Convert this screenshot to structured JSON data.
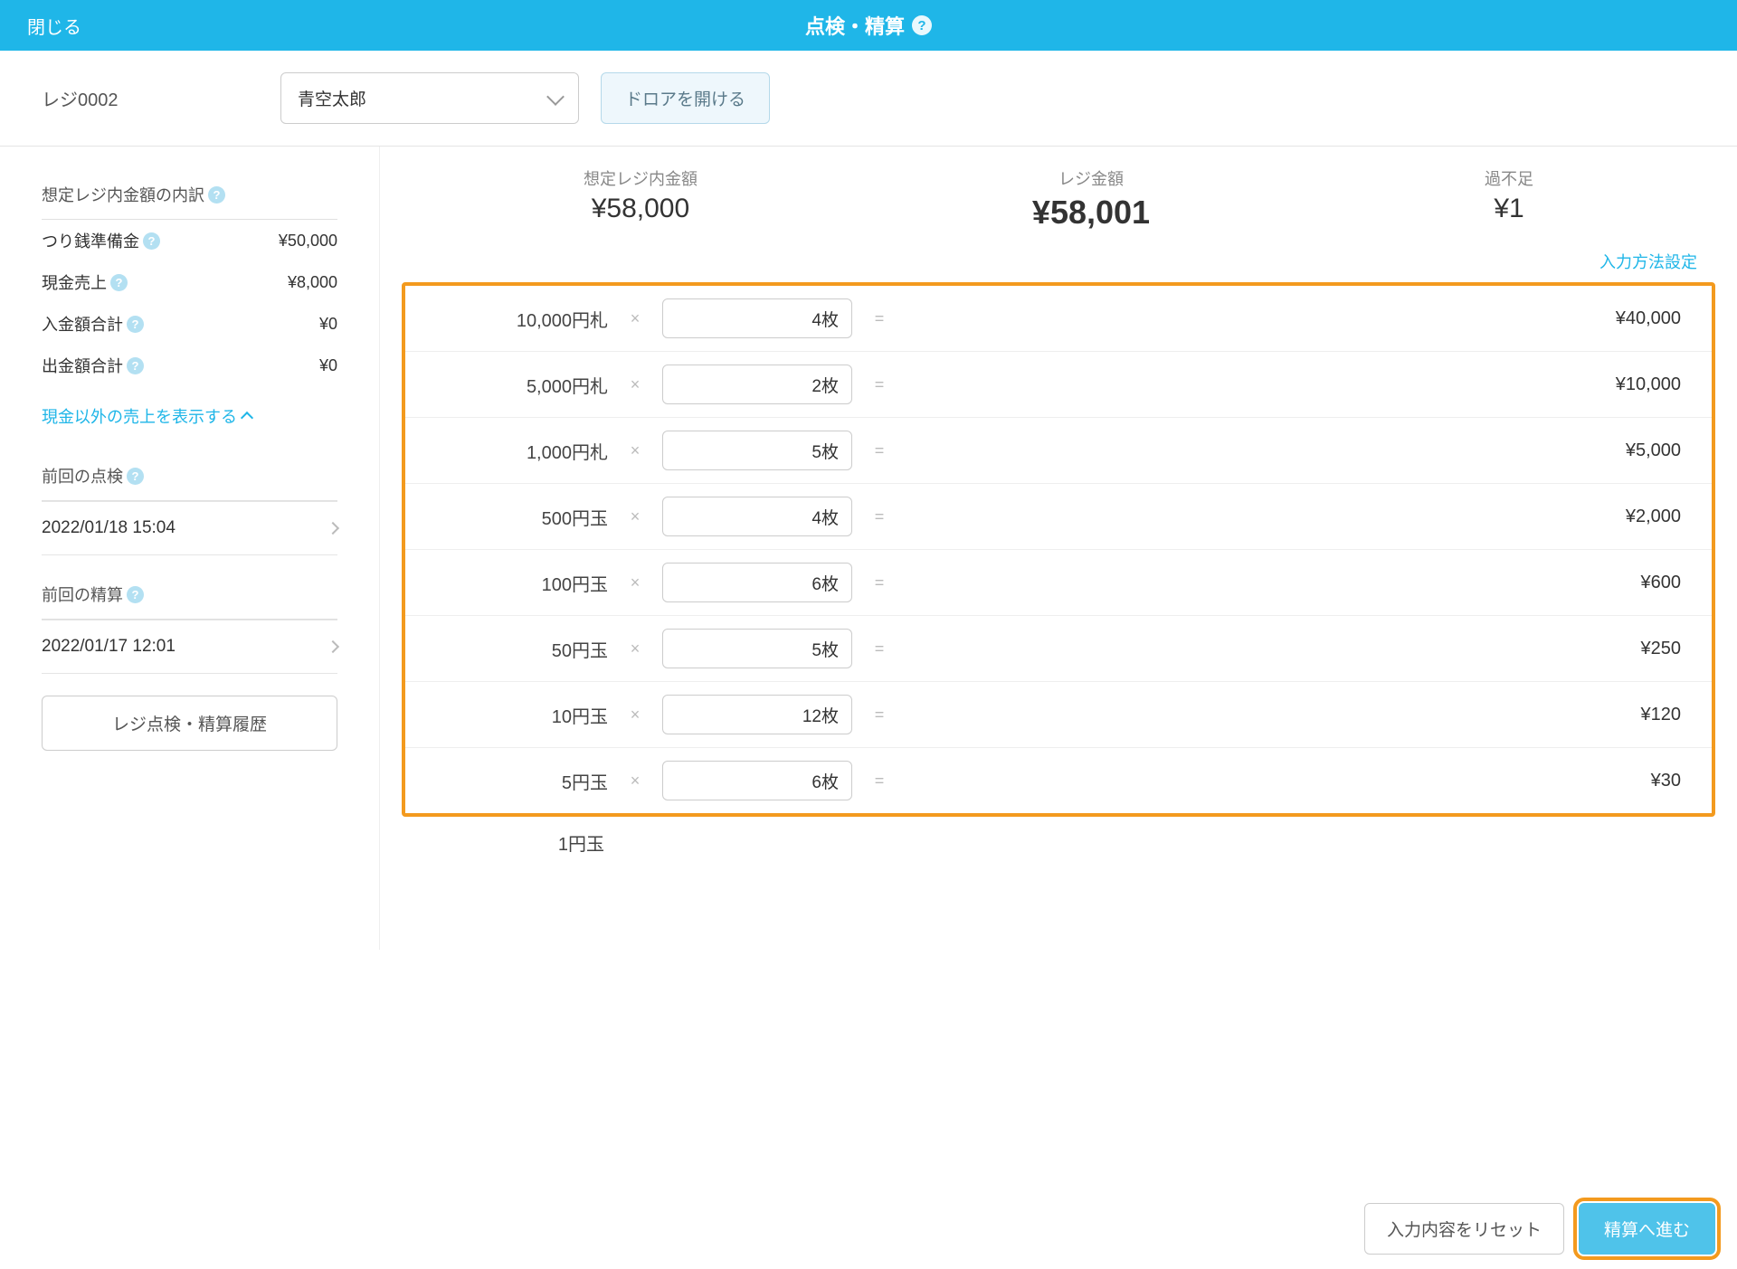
{
  "header": {
    "close": "閉じる",
    "title": "点検・精算"
  },
  "toolbar": {
    "register_label": "レジ0002",
    "staff_name": "青空太郎",
    "open_drawer": "ドロアを開ける"
  },
  "sidebar": {
    "breakdown_title": "想定レジ内金額の内訳",
    "rows": {
      "change_fund_label": "つり銭準備金",
      "change_fund_value": "¥50,000",
      "cash_sales_label": "現金売上",
      "cash_sales_value": "¥8,000",
      "deposit_label": "入金額合計",
      "deposit_value": "¥0",
      "withdrawal_label": "出金額合計",
      "withdrawal_value": "¥0"
    },
    "toggle_link": "現金以外の売上を表示する",
    "prev_check_title": "前回の点検",
    "prev_check_time": "2022/01/18 15:04",
    "prev_settle_title": "前回の精算",
    "prev_settle_time": "2022/01/17 12:01",
    "history_button": "レジ点検・精算履歴"
  },
  "main": {
    "summary": {
      "expected_label": "想定レジ内金額",
      "expected_value": "¥58,000",
      "actual_label": "レジ金額",
      "actual_value": "¥58,001",
      "diff_label": "過不足",
      "diff_value": "¥1"
    },
    "input_settings_link": "入力方法設定",
    "denominations": [
      {
        "label": "10,000円札",
        "count": "4枚",
        "subtotal": "¥40,000"
      },
      {
        "label": "5,000円札",
        "count": "2枚",
        "subtotal": "¥10,000"
      },
      {
        "label": "1,000円札",
        "count": "5枚",
        "subtotal": "¥5,000"
      },
      {
        "label": "500円玉",
        "count": "4枚",
        "subtotal": "¥2,000"
      },
      {
        "label": "100円玉",
        "count": "6枚",
        "subtotal": "¥600"
      },
      {
        "label": "50円玉",
        "count": "5枚",
        "subtotal": "¥250"
      },
      {
        "label": "10円玉",
        "count": "12枚",
        "subtotal": "¥120"
      },
      {
        "label": "5円玉",
        "count": "6枚",
        "subtotal": "¥30"
      }
    ],
    "outside_row_label": "1円玉",
    "reset_button": "入力内容をリセット",
    "proceed_button": "精算へ進む"
  }
}
